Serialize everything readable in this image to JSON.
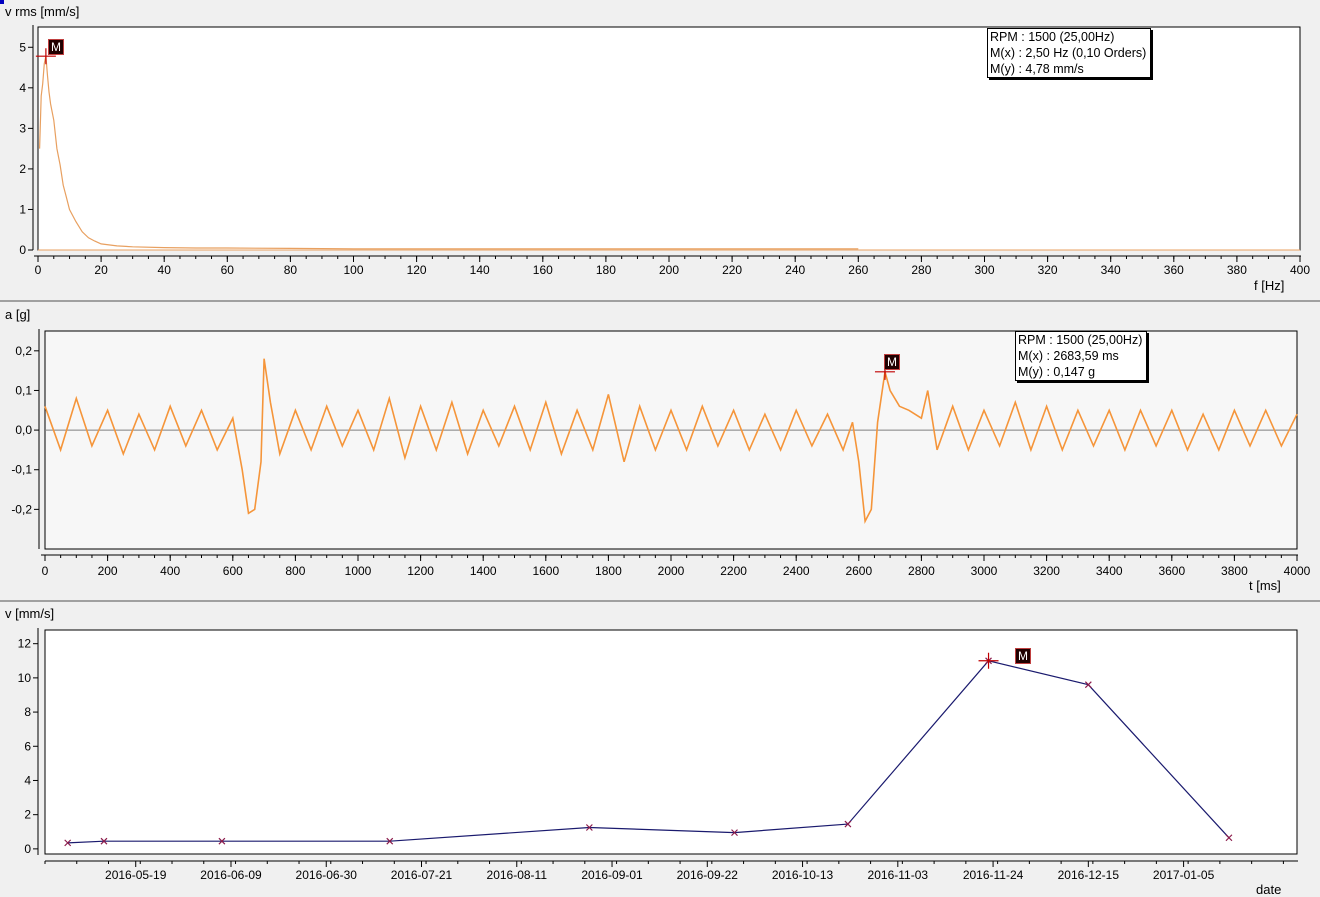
{
  "chart_data": [
    {
      "type": "line",
      "title": "",
      "ylabel": "v rms [mm/s]",
      "xlabel": "f [Hz]",
      "xlim": [
        0,
        400
      ],
      "ylim": [
        0,
        5.5
      ],
      "xticks": [
        0,
        20,
        40,
        60,
        80,
        100,
        120,
        140,
        160,
        180,
        200,
        220,
        240,
        260,
        280,
        300,
        320,
        340,
        360,
        380,
        400
      ],
      "yticks": [
        0,
        1,
        2,
        3,
        4,
        5
      ],
      "tick_labels_x": [
        "0",
        "20",
        "40",
        "60",
        "80",
        "100",
        "120",
        "140",
        "160",
        "180",
        "200",
        "220",
        "240",
        "260",
        "280",
        "300",
        "320",
        "340",
        "360",
        "380",
        "400"
      ],
      "tick_labels_y": [
        "0",
        "1",
        "2",
        "3",
        "4",
        "5"
      ],
      "series": [
        {
          "color": "#e8a060",
          "x": [
            0.5,
            1,
            1.5,
            2,
            2.5,
            3,
            3.5,
            4,
            5,
            6,
            7,
            8,
            9,
            10,
            12,
            14,
            16,
            18,
            20,
            25,
            30,
            40,
            50,
            60,
            80,
            100,
            150,
            200,
            260
          ],
          "y": [
            2.5,
            3.8,
            4.1,
            4.6,
            4.78,
            4.3,
            3.9,
            3.6,
            3.2,
            2.5,
            2.1,
            1.6,
            1.3,
            1.0,
            0.7,
            0.45,
            0.3,
            0.22,
            0.15,
            0.1,
            0.08,
            0.06,
            0.05,
            0.05,
            0.04,
            0.03,
            0.03,
            0.03,
            0.03
          ]
        }
      ],
      "marker": {
        "label": "M",
        "x": 2.5,
        "y": 4.78
      },
      "info": [
        "RPM : 1500 (25,00Hz)",
        "M(x) : 2,50 Hz (0,10 Orders)",
        "M(y) : 4,78 mm/s"
      ],
      "grid": false
    },
    {
      "type": "line",
      "title": "",
      "ylabel": "a [g]",
      "xlabel": "t [ms]",
      "xlim": [
        0,
        4000
      ],
      "ylim": [
        -0.3,
        0.25
      ],
      "xticks": [
        0,
        200,
        400,
        600,
        800,
        1000,
        1200,
        1400,
        1600,
        1800,
        2000,
        2200,
        2400,
        2600,
        2800,
        3000,
        3200,
        3400,
        3600,
        3800,
        4000
      ],
      "yticks": [
        -0.2,
        -0.1,
        0.0,
        0.1,
        0.2
      ],
      "tick_labels_x": [
        "0",
        "200",
        "400",
        "600",
        "800",
        "1000",
        "1200",
        "1400",
        "1600",
        "1800",
        "2000",
        "2200",
        "2400",
        "2600",
        "2800",
        "3000",
        "3200",
        "3400",
        "3600",
        "3800",
        "4000"
      ],
      "tick_labels_y": [
        "-0,2",
        "-0,1",
        "0,0",
        "0,1",
        "0,2"
      ],
      "series": [
        {
          "color": "#f5953a",
          "x": [
            0,
            50,
            100,
            150,
            200,
            250,
            300,
            350,
            400,
            450,
            500,
            550,
            600,
            630,
            650,
            670,
            690,
            700,
            720,
            750,
            800,
            850,
            900,
            950,
            1000,
            1050,
            1100,
            1150,
            1200,
            1250,
            1300,
            1350,
            1400,
            1450,
            1500,
            1550,
            1600,
            1650,
            1700,
            1750,
            1800,
            1850,
            1900,
            1950,
            2000,
            2050,
            2100,
            2150,
            2200,
            2250,
            2300,
            2350,
            2400,
            2450,
            2500,
            2550,
            2580,
            2600,
            2620,
            2640,
            2660,
            2683.59,
            2700,
            2730,
            2760,
            2800,
            2820,
            2850,
            2900,
            2950,
            3000,
            3050,
            3100,
            3150,
            3200,
            3250,
            3300,
            3350,
            3400,
            3450,
            3500,
            3550,
            3600,
            3650,
            3700,
            3750,
            3800,
            3850,
            3900,
            3950,
            4000
          ],
          "y": [
            0.06,
            -0.05,
            0.08,
            -0.04,
            0.05,
            -0.06,
            0.04,
            -0.05,
            0.06,
            -0.04,
            0.05,
            -0.05,
            0.03,
            -0.1,
            -0.21,
            -0.2,
            -0.08,
            0.18,
            0.07,
            -0.06,
            0.05,
            -0.05,
            0.06,
            -0.04,
            0.05,
            -0.05,
            0.08,
            -0.07,
            0.06,
            -0.05,
            0.07,
            -0.06,
            0.05,
            -0.04,
            0.06,
            -0.05,
            0.07,
            -0.06,
            0.05,
            -0.05,
            0.09,
            -0.08,
            0.06,
            -0.05,
            0.05,
            -0.05,
            0.06,
            -0.04,
            0.05,
            -0.05,
            0.04,
            -0.05,
            0.05,
            -0.04,
            0.04,
            -0.05,
            0.02,
            -0.08,
            -0.23,
            -0.2,
            0.02,
            0.147,
            0.1,
            0.06,
            0.05,
            0.03,
            0.1,
            -0.05,
            0.06,
            -0.05,
            0.05,
            -0.04,
            0.07,
            -0.05,
            0.06,
            -0.05,
            0.05,
            -0.04,
            0.05,
            -0.05,
            0.05,
            -0.04,
            0.05,
            -0.05,
            0.04,
            -0.05,
            0.05,
            -0.04,
            0.05,
            -0.04,
            0.04
          ]
        }
      ],
      "marker": {
        "label": "M",
        "x": 2683.59,
        "y": 0.147
      },
      "info": [
        "RPM : 1500 (25,00Hz)",
        "M(x) : 2683,59 ms",
        "M(y) : 0,147 g"
      ],
      "grid": false
    },
    {
      "type": "line",
      "title": "",
      "ylabel": "v [mm/s]",
      "xlabel": "date",
      "xlim": [
        "2016-04-29",
        "2017-01-30"
      ],
      "ylim": [
        -0.3,
        12.8
      ],
      "xticks": [
        "2016-05-19",
        "2016-06-09",
        "2016-06-30",
        "2016-07-21",
        "2016-08-11",
        "2016-09-01",
        "2016-09-22",
        "2016-10-13",
        "2016-11-03",
        "2016-11-24",
        "2016-12-15",
        "2017-01-05"
      ],
      "yticks": [
        0,
        2,
        4,
        6,
        8,
        10,
        12
      ],
      "tick_labels_x": [
        "2016-05-19",
        "2016-06-09",
        "2016-06-30",
        "2016-07-21",
        "2016-08-11",
        "2016-09-01",
        "2016-09-22",
        "2016-10-13",
        "2016-11-03",
        "2016-11-24",
        "2016-12-15",
        "2017-01-05"
      ],
      "tick_labels_y": [
        "0",
        "2",
        "4",
        "6",
        "8",
        "10",
        "12"
      ],
      "series": [
        {
          "color": "#1a1a6e",
          "marker_color": "#8b1a4a",
          "x": [
            "2016-05-04",
            "2016-05-12",
            "2016-06-07",
            "2016-07-14",
            "2016-08-27",
            "2016-09-28",
            "2016-10-23",
            "2016-11-23",
            "2016-12-15",
            "2017-01-15"
          ],
          "y": [
            0.35,
            0.45,
            0.45,
            0.45,
            1.25,
            0.95,
            1.45,
            11.0,
            9.6,
            0.65
          ]
        }
      ],
      "marker": {
        "label": "M",
        "x": "2016-11-23",
        "y": 11.0
      },
      "grid": false
    }
  ]
}
